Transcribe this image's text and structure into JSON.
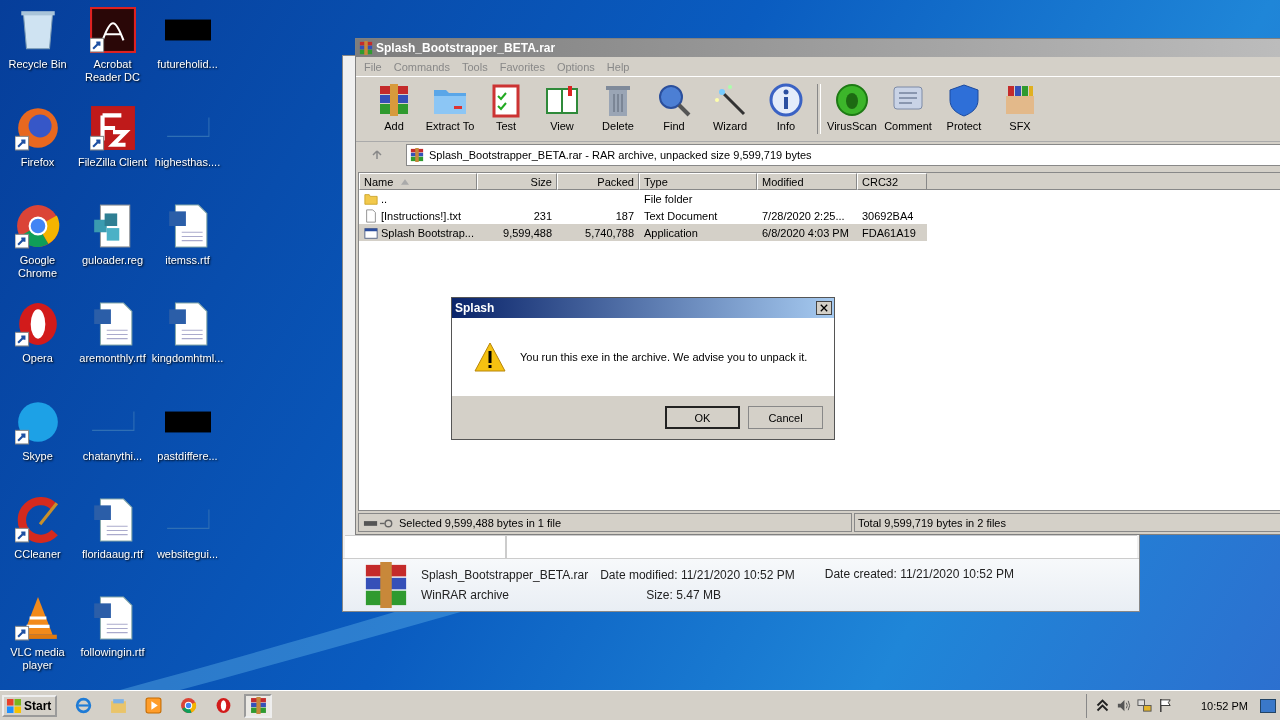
{
  "desktop_icons": [
    {
      "label": "Recycle Bin",
      "kind": "recycle",
      "shortcut": false
    },
    {
      "label": "Acrobat Reader DC",
      "kind": "acrobat",
      "shortcut": true
    },
    {
      "label": "futureholid...",
      "kind": "black",
      "shortcut": false
    },
    {
      "label": "Firefox",
      "kind": "firefox",
      "shortcut": true
    },
    {
      "label": "FileZilla Client",
      "kind": "filezilla",
      "shortcut": true
    },
    {
      "label": "highesthas....",
      "kind": "blank",
      "shortcut": false
    },
    {
      "label": "Google Chrome",
      "kind": "chrome",
      "shortcut": true
    },
    {
      "label": "guloader.reg",
      "kind": "reg",
      "shortcut": false
    },
    {
      "label": "itemss.rtf",
      "kind": "word",
      "shortcut": false
    },
    {
      "label": "Opera",
      "kind": "opera",
      "shortcut": true
    },
    {
      "label": "aremonthly.rtf",
      "kind": "word",
      "shortcut": false
    },
    {
      "label": "kingdomhtml...",
      "kind": "word",
      "shortcut": false
    },
    {
      "label": "Skype",
      "kind": "skype",
      "shortcut": true
    },
    {
      "label": "chatanythi...",
      "kind": "blank",
      "shortcut": false
    },
    {
      "label": "pastdiffere...",
      "kind": "black",
      "shortcut": false
    },
    {
      "label": "CCleaner",
      "kind": "ccleaner",
      "shortcut": true
    },
    {
      "label": "floridaaug.rtf",
      "kind": "word",
      "shortcut": false
    },
    {
      "label": "websitegui...",
      "kind": "blank",
      "shortcut": false
    },
    {
      "label": "VLC media player",
      "kind": "vlc",
      "shortcut": true
    },
    {
      "label": "followingin.rtf",
      "kind": "word",
      "shortcut": false
    }
  ],
  "explorer": {
    "details": {
      "filename": "Splash_Bootstrapper_BETA.rar",
      "type": "WinRAR archive",
      "modified": "Date modified: 11/21/2020 10:52 PM",
      "size": "Size: 5.47 MB",
      "created": "Date created: 11/21/2020 10:52 PM"
    }
  },
  "winrar": {
    "title": "Splash_Bootstrapper_BETA.rar",
    "menu": [
      "File",
      "Commands",
      "Tools",
      "Favorites",
      "Options",
      "Help"
    ],
    "toolbar": [
      {
        "label": "Add",
        "kind": "add",
        "separator_before": false
      },
      {
        "label": "Extract To",
        "kind": "extract",
        "separator_before": false
      },
      {
        "label": "Test",
        "kind": "test",
        "separator_before": false
      },
      {
        "label": "View",
        "kind": "view",
        "separator_before": false
      },
      {
        "label": "Delete",
        "kind": "delete",
        "separator_before": false
      },
      {
        "label": "Find",
        "kind": "find",
        "separator_before": false
      },
      {
        "label": "Wizard",
        "kind": "wizard",
        "separator_before": false
      },
      {
        "label": "Info",
        "kind": "info",
        "separator_before": false
      },
      {
        "label": "VirusScan",
        "kind": "virus",
        "separator_before": true
      },
      {
        "label": "Comment",
        "kind": "comment",
        "separator_before": false
      },
      {
        "label": "Protect",
        "kind": "protect",
        "separator_before": false
      },
      {
        "label": "SFX",
        "kind": "sfx",
        "separator_before": false
      }
    ],
    "address": "Splash_Bootstrapper_BETA.rar - RAR archive, unpacked size 9,599,719 bytes",
    "columns": [
      {
        "label": "Name",
        "sorted": true
      },
      {
        "label": "Size",
        "sorted": false
      },
      {
        "label": "Packed",
        "sorted": false
      },
      {
        "label": "Type",
        "sorted": false
      },
      {
        "label": "Modified",
        "sorted": false
      },
      {
        "label": "CRC32",
        "sorted": false
      }
    ],
    "rows": [
      {
        "kind": "folder",
        "cells": [
          "..",
          "",
          "",
          "File folder",
          "",
          ""
        ],
        "selected": false
      },
      {
        "kind": "text",
        "cells": [
          "[Instructions!].txt",
          "231",
          "187",
          "Text Document",
          "7/28/2020 2:25...",
          "30692BA4"
        ],
        "selected": false
      },
      {
        "kind": "app",
        "cells": [
          "Splash Bootstrap...",
          "9,599,488",
          "5,740,788",
          "Application",
          "6/8/2020 4:03 PM",
          "FDA61A19"
        ],
        "selected": true
      }
    ],
    "status_left": "Selected 9,599,488 bytes in 1 file",
    "status_right": "Total 9,599,719 bytes in 2 files"
  },
  "dialog": {
    "title": "Splash",
    "message": "You run this exe in the archive. We advise you to unpack it.",
    "buttons": [
      {
        "label": "OK",
        "default": true
      },
      {
        "label": "Cancel",
        "default": false
      }
    ]
  },
  "taskbar": {
    "start": "Start",
    "apps": [
      {
        "kind": "ie",
        "active": false
      },
      {
        "kind": "explorer",
        "active": false
      },
      {
        "kind": "media",
        "active": false
      },
      {
        "kind": "chrome",
        "active": false
      },
      {
        "kind": "opera",
        "active": false
      },
      {
        "kind": "winrar",
        "active": true
      }
    ],
    "time": "10:52 PM"
  }
}
